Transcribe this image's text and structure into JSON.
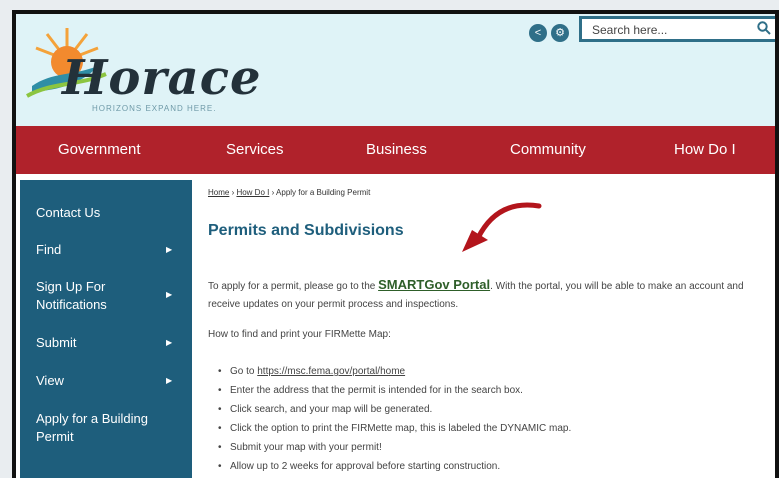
{
  "header": {
    "logo_text": "Horace",
    "logo_tagline": "HORIZONS EXPAND HERE.",
    "share_icon": "share-icon",
    "settings_icon": "gear-icon",
    "search": {
      "placeholder": "Search here..."
    }
  },
  "nav": {
    "items": [
      {
        "label": "Government"
      },
      {
        "label": "Services"
      },
      {
        "label": "Business"
      },
      {
        "label": "Community"
      },
      {
        "label": "How Do I"
      }
    ]
  },
  "sidebar": {
    "items": [
      {
        "label": "Contact Us"
      },
      {
        "label": "Find"
      },
      {
        "label": "Sign Up For Notifications"
      },
      {
        "label": "Submit"
      },
      {
        "label": "View"
      },
      {
        "label": "Apply for a Building Permit"
      }
    ]
  },
  "breadcrumb": {
    "home": "Home",
    "sep1": " › ",
    "how_do_i": "How Do I",
    "sep2": " › ",
    "current": "Apply for a Building Permit"
  },
  "main": {
    "title": "Permits and Subdivisions",
    "intro_before": "To apply for a permit, please go to the ",
    "portal_link": "SMARTGov Portal",
    "intro_after": ". With the portal, you will be able to make an account and receive updates on your permit process and inspections.",
    "firmette_heading": "How to find and print your FIRMette Map:",
    "bullets": {
      "b1_prefix": "Go to ",
      "b1_link": "https://msc.fema.gov/portal/home",
      "b2": "Enter the address that the permit is intended for in the search box.",
      "b3": "Click search, and your map will be generated.",
      "b4": "Click the option to print the FIRMette map, this is labeled the DYNAMIC map.",
      "b5": "Submit your map with your permit!",
      "b6": "Allow up to 2 weeks for approval before starting construction."
    }
  },
  "colors": {
    "nav_red": "#b0222b",
    "sidebar_teal": "#1e5e7c",
    "header_bg": "#dff3f7",
    "portal_green": "#2e5e29",
    "annotation_arrow": "#b3151c"
  }
}
